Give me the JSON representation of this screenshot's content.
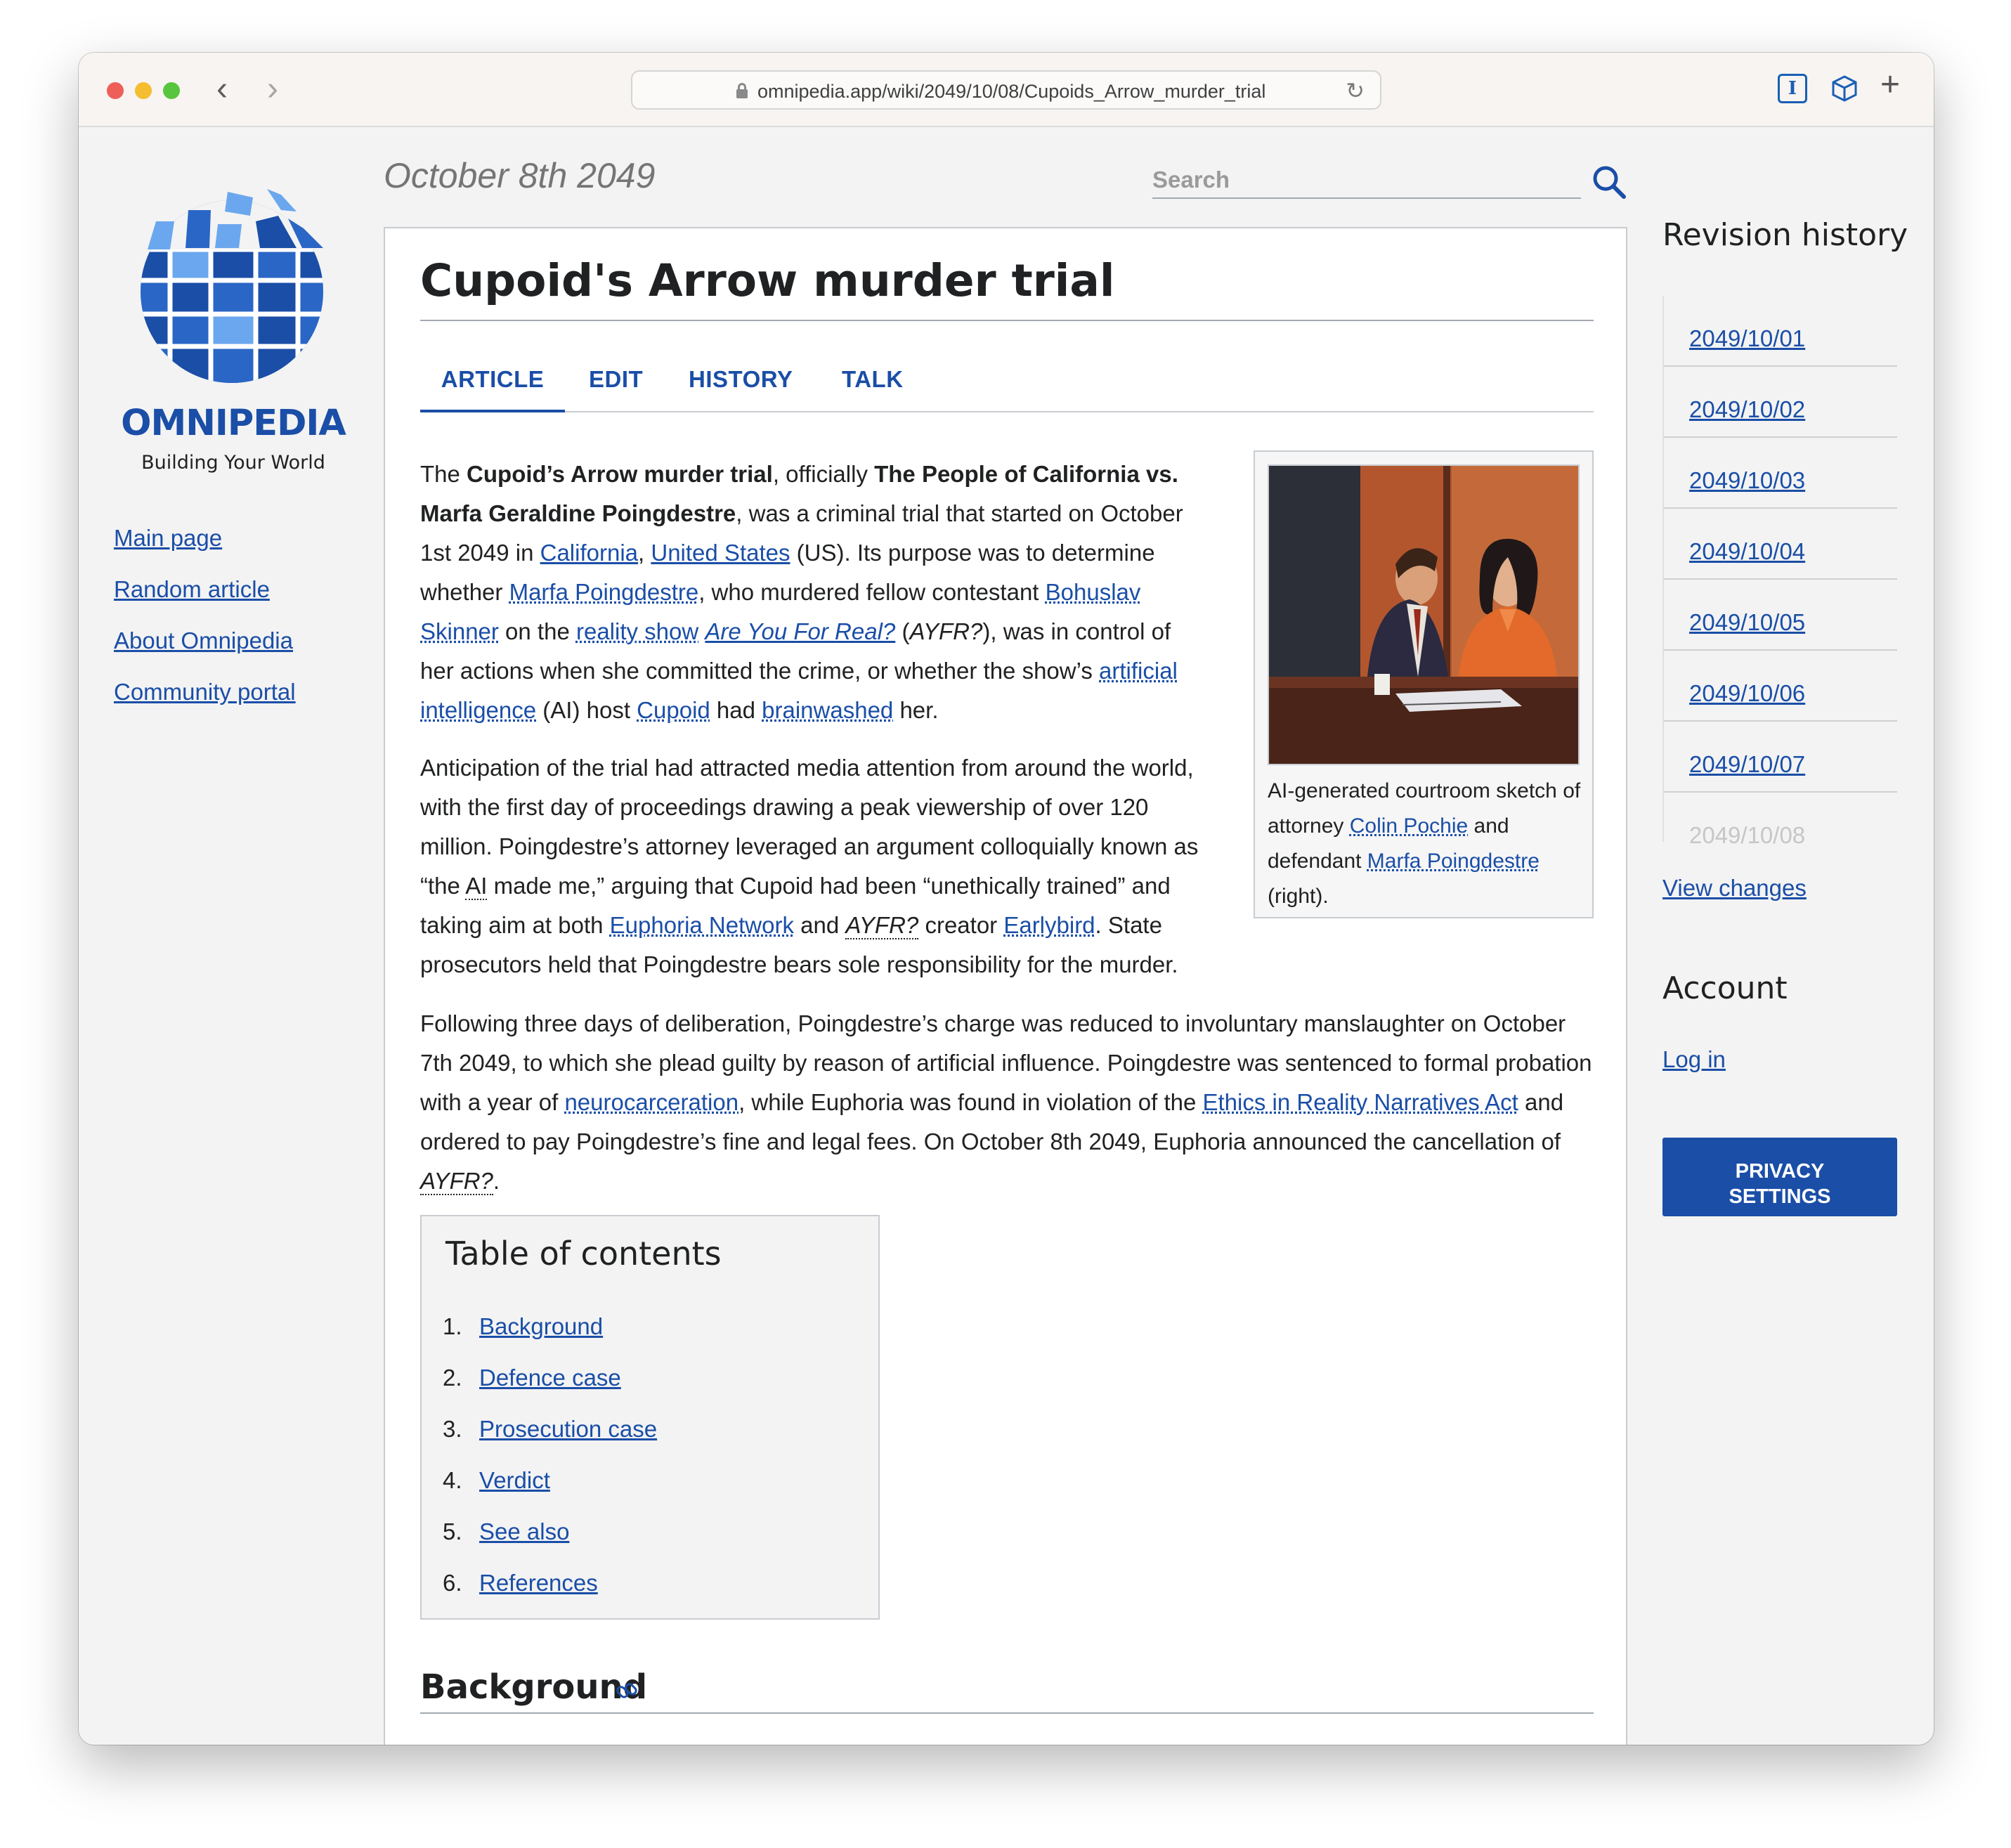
{
  "browser": {
    "url": "omnipedia.app/wiki/2049/10/08/Cupoids_Arrow_murder_trial"
  },
  "site": {
    "name": "OMNIPEDIA",
    "tagline": "Building Your World",
    "date_title": "October 8th 2049",
    "search_placeholder": "Search",
    "nav": [
      "Main page",
      "Random article",
      "About Omnipedia",
      "Community portal"
    ]
  },
  "article": {
    "title": "Cupoid's Arrow murder trial",
    "tabs": [
      "ARTICLE",
      "EDIT",
      "HISTORY",
      "TALK"
    ],
    "figure_caption": {
      "t1": "AI-generated courtroom sketch of attorney ",
      "link1": "Colin Pochie",
      "t2": " and defendant ",
      "link2": "Marfa Poingdestre",
      "t3": " (right)."
    },
    "p1": {
      "t1": "The ",
      "b1": "Cupoid’s Arrow murder trial",
      "t2": ", officially ",
      "b2": "The People of California vs. Marfa Geraldine Poingdestre",
      "t3": ", was a criminal trial that started on October 1st 2049 in ",
      "l1": "California",
      "t4": ", ",
      "l2": "United States",
      "t5": " (US). Its purpose was to determine whether ",
      "l3": "Marfa Poingdestre",
      "t6": ", who murdered fellow contestant ",
      "l4": "Bohuslav Skinner",
      "t7": " on the ",
      "l5": "reality show",
      "t8": " ",
      "l6": "Are You For Real?",
      "t9": " (",
      "i1": "AYFR?",
      "t10": "), was in control of her actions when she committed the crime, or whether the show’s ",
      "l7": "artificial intelligence",
      "t11": " (AI) host ",
      "l8": "Cupoid",
      "t12": " had ",
      "l9": "brainwashed",
      "t13": " her."
    },
    "p2": {
      "t1": "Anticipation of the trial had attracted media attention from around the world, with the first day of proceedings drawing a peak viewership of over 120 million. Poingdestre’s attorney leveraged an argument colloquially known as “the ",
      "a1": "AI",
      "t2": " made me,” arguing that Cupoid had been “unethically trained” and taking aim at both ",
      "l1": "Euphoria Network",
      "t3": " and ",
      "i1": "AYFR?",
      "t4": " creator ",
      "l2": "Earlybird",
      "t5": ". State prosecutors held that Poingdestre bears sole responsibility for the murder."
    },
    "p3": {
      "t1": "Following three days of deliberation, Poingdestre’s charge was reduced to involuntary manslaughter on October 7th 2049, to which she plead guilty by reason of artificial influence. Poingdestre was sentenced to formal probation with a year of ",
      "l1": "neurocarceration",
      "t2": ", while Euphoria was found in violation of the ",
      "l2": "Ethics in Reality Narratives Act",
      "t3": " and ordered to pay Poingdestre’s fine and legal fees. On October 8th 2049, Euphoria announced the cancellation of ",
      "i1": "AYFR?",
      "t4": "."
    },
    "toc": {
      "title": "Table of contents",
      "items": [
        {
          "num": "1.",
          "label": "Background"
        },
        {
          "num": "2.",
          "label": "Defence case"
        },
        {
          "num": "3.",
          "label": "Prosecution case"
        },
        {
          "num": "4.",
          "label": "Verdict"
        },
        {
          "num": "5.",
          "label": "See also"
        },
        {
          "num": "6.",
          "label": "References"
        }
      ]
    },
    "section_heading": "Background"
  },
  "sidebar_right": {
    "revision_title": "Revision history",
    "revisions": [
      "2049/10/01",
      "2049/10/02",
      "2049/10/03",
      "2049/10/04",
      "2049/10/05",
      "2049/10/06",
      "2049/10/07",
      "2049/10/08"
    ],
    "view_changes": "View changes",
    "account_title": "Account",
    "login": "Log in",
    "privacy_line1": "PRIVACY",
    "privacy_line2": "SETTINGS"
  },
  "colors": {
    "link": "#1a4ea7",
    "brand": "#1a4ea7",
    "button_bg": "#1a4ea7"
  },
  "icons": [
    "lock-icon",
    "reload-icon",
    "back-arrow-icon",
    "forward-arrow-icon",
    "reader-icon",
    "box-icon",
    "new-tab-icon",
    "search-icon",
    "globe-logo-icon",
    "section-link-icon"
  ]
}
